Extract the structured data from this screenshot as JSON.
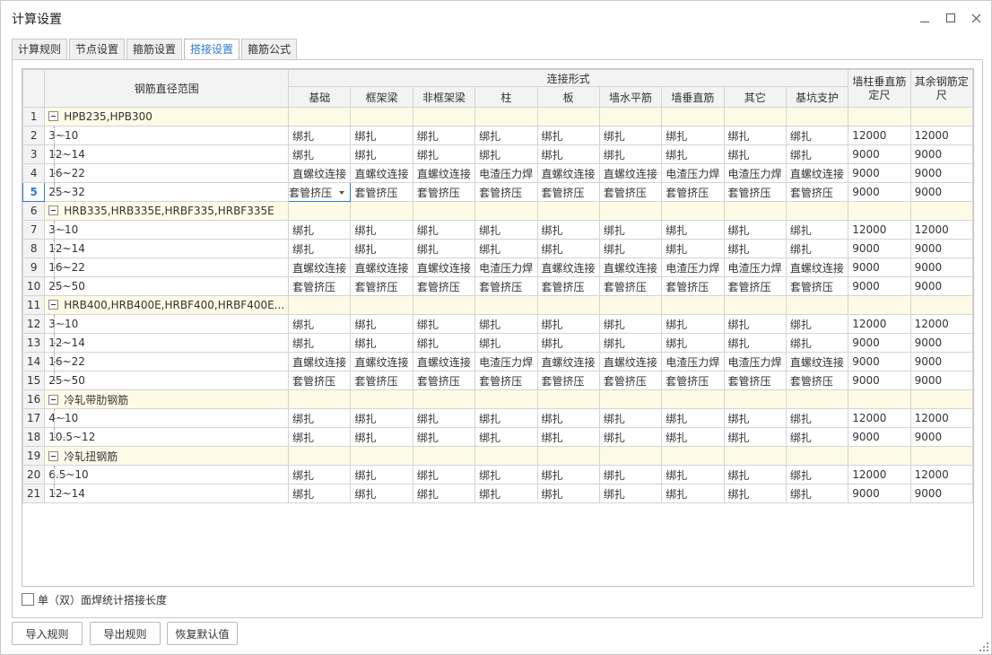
{
  "window": {
    "title": "计算设置"
  },
  "tabs": [
    {
      "label": "计算规则",
      "active": false
    },
    {
      "label": "节点设置",
      "active": false
    },
    {
      "label": "箍筋设置",
      "active": false
    },
    {
      "label": "搭接设置",
      "active": true
    },
    {
      "label": "箍筋公式",
      "active": false
    }
  ],
  "grid": {
    "header": {
      "range_col": "钢筋直径范围",
      "group": "连接形式",
      "sub": [
        "基础",
        "框架梁",
        "非框架梁",
        "柱",
        "板",
        "墙水平筋",
        "墙垂直筋",
        "其它",
        "基坑支护"
      ],
      "wall_length_line1": "墙柱垂直筋",
      "wall_length_line2": "定尺",
      "other_length_line1": "其余钢筋定",
      "other_length_line2": "尺"
    },
    "selected_row": 5,
    "rows": [
      {
        "n": "1",
        "type": "group",
        "label": "HPB235,HPB300"
      },
      {
        "n": "2",
        "type": "data",
        "range": "3~10",
        "cells": [
          "绑扎",
          "绑扎",
          "绑扎",
          "绑扎",
          "绑扎",
          "绑扎",
          "绑扎",
          "绑扎",
          "绑扎",
          "12000",
          "12000"
        ]
      },
      {
        "n": "3",
        "type": "data",
        "range": "12~14",
        "cells": [
          "绑扎",
          "绑扎",
          "绑扎",
          "绑扎",
          "绑扎",
          "绑扎",
          "绑扎",
          "绑扎",
          "绑扎",
          "9000",
          "9000"
        ]
      },
      {
        "n": "4",
        "type": "data",
        "range": "16~22",
        "cells": [
          "直螺纹连接",
          "直螺纹连接",
          "直螺纹连接",
          "电渣压力焊",
          "直螺纹连接",
          "直螺纹连接",
          "电渣压力焊",
          "电渣压力焊",
          "直螺纹连接",
          "9000",
          "9000"
        ]
      },
      {
        "n": "5",
        "type": "data",
        "range": "25~32",
        "last": true,
        "cells": [
          "套管挤压",
          "套管挤压",
          "套管挤压",
          "套管挤压",
          "套管挤压",
          "套管挤压",
          "套管挤压",
          "套管挤压",
          "套管挤压",
          "9000",
          "9000"
        ]
      },
      {
        "n": "6",
        "type": "group",
        "label": "HRB335,HRB335E,HRBF335,HRBF335E"
      },
      {
        "n": "7",
        "type": "data",
        "range": "3~10",
        "cells": [
          "绑扎",
          "绑扎",
          "绑扎",
          "绑扎",
          "绑扎",
          "绑扎",
          "绑扎",
          "绑扎",
          "绑扎",
          "12000",
          "12000"
        ]
      },
      {
        "n": "8",
        "type": "data",
        "range": "12~14",
        "cells": [
          "绑扎",
          "绑扎",
          "绑扎",
          "绑扎",
          "绑扎",
          "绑扎",
          "绑扎",
          "绑扎",
          "绑扎",
          "9000",
          "9000"
        ]
      },
      {
        "n": "9",
        "type": "data",
        "range": "16~22",
        "cells": [
          "直螺纹连接",
          "直螺纹连接",
          "直螺纹连接",
          "电渣压力焊",
          "直螺纹连接",
          "直螺纹连接",
          "电渣压力焊",
          "电渣压力焊",
          "直螺纹连接",
          "9000",
          "9000"
        ]
      },
      {
        "n": "10",
        "type": "data",
        "range": "25~50",
        "last": true,
        "cells": [
          "套管挤压",
          "套管挤压",
          "套管挤压",
          "套管挤压",
          "套管挤压",
          "套管挤压",
          "套管挤压",
          "套管挤压",
          "套管挤压",
          "9000",
          "9000"
        ]
      },
      {
        "n": "11",
        "type": "group",
        "label": "HRB400,HRB400E,HRBF400,HRBF400E..."
      },
      {
        "n": "12",
        "type": "data",
        "range": "3~10",
        "cells": [
          "绑扎",
          "绑扎",
          "绑扎",
          "绑扎",
          "绑扎",
          "绑扎",
          "绑扎",
          "绑扎",
          "绑扎",
          "12000",
          "12000"
        ]
      },
      {
        "n": "13",
        "type": "data",
        "range": "12~14",
        "cells": [
          "绑扎",
          "绑扎",
          "绑扎",
          "绑扎",
          "绑扎",
          "绑扎",
          "绑扎",
          "绑扎",
          "绑扎",
          "9000",
          "9000"
        ]
      },
      {
        "n": "14",
        "type": "data",
        "range": "16~22",
        "cells": [
          "直螺纹连接",
          "直螺纹连接",
          "直螺纹连接",
          "电渣压力焊",
          "直螺纹连接",
          "直螺纹连接",
          "电渣压力焊",
          "电渣压力焊",
          "直螺纹连接",
          "9000",
          "9000"
        ]
      },
      {
        "n": "15",
        "type": "data",
        "range": "25~50",
        "last": true,
        "cells": [
          "套管挤压",
          "套管挤压",
          "套管挤压",
          "套管挤压",
          "套管挤压",
          "套管挤压",
          "套管挤压",
          "套管挤压",
          "套管挤压",
          "9000",
          "9000"
        ]
      },
      {
        "n": "16",
        "type": "group",
        "label": "冷轧带肋钢筋"
      },
      {
        "n": "17",
        "type": "data",
        "range": "4~10",
        "cells": [
          "绑扎",
          "绑扎",
          "绑扎",
          "绑扎",
          "绑扎",
          "绑扎",
          "绑扎",
          "绑扎",
          "绑扎",
          "12000",
          "12000"
        ]
      },
      {
        "n": "18",
        "type": "data",
        "range": "10.5~12",
        "last": true,
        "cells": [
          "绑扎",
          "绑扎",
          "绑扎",
          "绑扎",
          "绑扎",
          "绑扎",
          "绑扎",
          "绑扎",
          "绑扎",
          "9000",
          "9000"
        ]
      },
      {
        "n": "19",
        "type": "group",
        "label": "冷轧扭钢筋"
      },
      {
        "n": "20",
        "type": "data",
        "range": "6.5~10",
        "cells": [
          "绑扎",
          "绑扎",
          "绑扎",
          "绑扎",
          "绑扎",
          "绑扎",
          "绑扎",
          "绑扎",
          "绑扎",
          "12000",
          "12000"
        ]
      },
      {
        "n": "21",
        "type": "data",
        "range": "12~14",
        "last": true,
        "cells": [
          "绑扎",
          "绑扎",
          "绑扎",
          "绑扎",
          "绑扎",
          "绑扎",
          "绑扎",
          "绑扎",
          "绑扎",
          "9000",
          "9000"
        ]
      }
    ]
  },
  "footer": {
    "checkbox_label": "单（双）面焊统计搭接长度",
    "checkbox_checked": false,
    "buttons": {
      "import": "导入规则",
      "export": "导出规则",
      "restore": "恢复默认值"
    }
  },
  "colors": {
    "accent": "#2d7bd6",
    "header_blue": "#65b1f1",
    "group_row": "#fdfbe6"
  }
}
